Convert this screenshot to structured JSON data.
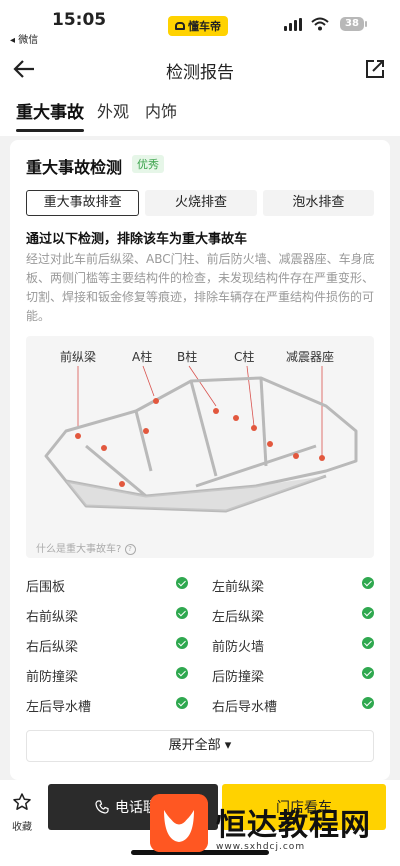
{
  "status_bar": {
    "time": "15:05",
    "back_app": "◂ 微信",
    "app_pill": "懂车帝",
    "battery": "38"
  },
  "header": {
    "title": "检测报告"
  },
  "tabs": [
    {
      "label": "重大事故",
      "active": true
    },
    {
      "label": "外观",
      "active": false
    },
    {
      "label": "内饰",
      "active": false
    }
  ],
  "card": {
    "title": "重大事故检测",
    "badge": "优秀",
    "subtabs": [
      {
        "label": "重大事故排查",
        "active": true
      },
      {
        "label": "火烧排查",
        "active": false
      },
      {
        "label": "泡水排查",
        "active": false
      }
    ],
    "lead": "通过以下检测，排除该车为重大事故车",
    "description": "经过对此车前后纵梁、ABC门柱、前后防火墙、减震器座、车身底板、两侧门槛等主要结构件的检查，未发现结构件存在严重变形、切割、焊接和钣金修复等痕迹，排除车辆存在严重结构件损伤的可能。",
    "diagram": {
      "labels": [
        "前纵梁",
        "A柱",
        "B柱",
        "C柱",
        "减震器座"
      ],
      "ask": "什么是重大事故车?"
    },
    "checks": [
      {
        "left": "后围板",
        "right": "左前纵梁"
      },
      {
        "left": "右前纵梁",
        "right": "左后纵梁"
      },
      {
        "left": "右后纵梁",
        "right": "前防火墙"
      },
      {
        "left": "前防撞梁",
        "right": "后防撞梁"
      },
      {
        "left": "左后导水槽",
        "right": "右后导水槽"
      }
    ],
    "expand": "展开全部 ▾"
  },
  "bottom": {
    "fav_label": "收藏",
    "call_label": "电话联系",
    "buy_label": "门店看车"
  },
  "watermark": {
    "text": "恒达教程网",
    "url": "www.sxhdcj.com"
  },
  "colors": {
    "accent": "#ffd200",
    "ok": "#2fa84f",
    "dark_button": "#2b2b2b"
  }
}
